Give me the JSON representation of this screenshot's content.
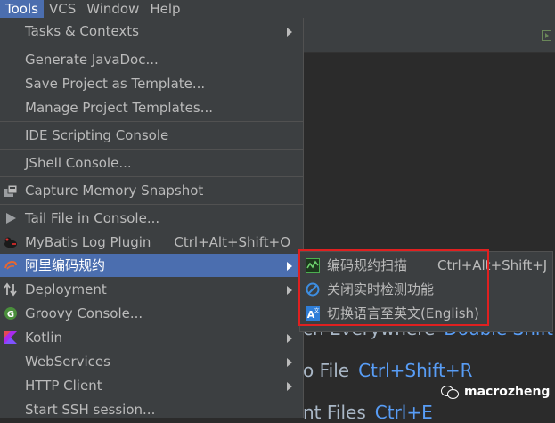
{
  "menubar": {
    "items": [
      {
        "label": "Tools",
        "active": true
      },
      {
        "label": "VCS"
      },
      {
        "label": "Window"
      },
      {
        "label": "Help"
      }
    ]
  },
  "tools_menu": {
    "items": [
      {
        "label": "Tasks & Contexts",
        "submenu": true
      },
      {
        "label": "Generate JavaDoc..."
      },
      {
        "label": "Save Project as Template..."
      },
      {
        "label": "Manage Project Templates..."
      },
      {
        "label": "IDE Scripting Console"
      },
      {
        "label": "JShell Console..."
      },
      {
        "label": "Capture Memory Snapshot",
        "icon": "memory-snapshot-icon"
      },
      {
        "label": "Tail File in Console...",
        "icon": "play-icon"
      },
      {
        "label": "MyBatis Log Plugin",
        "shortcut": "Ctrl+Alt+Shift+O",
        "icon": "bird-icon"
      },
      {
        "label": "阿里编码规约",
        "submenu": true,
        "selected": true,
        "icon": "alibaba-icon"
      },
      {
        "label": "Deployment",
        "submenu": true,
        "icon": "deployment-arrows-icon"
      },
      {
        "label": "Groovy Console...",
        "icon": "groovy-icon"
      },
      {
        "label": "Kotlin",
        "submenu": true,
        "icon": "kotlin-icon"
      },
      {
        "label": "WebServices",
        "submenu": true
      },
      {
        "label": "HTTP Client",
        "submenu": true
      },
      {
        "label": "Start SSH session..."
      }
    ]
  },
  "alibaba_submenu": {
    "items": [
      {
        "label": "编码规约扫描",
        "shortcut": "Ctrl+Alt+Shift+J",
        "icon": "scan-chart-icon"
      },
      {
        "label": "关闭实时检测功能",
        "icon": "disable-circle-icon"
      },
      {
        "label": "切换语言至英文(English)",
        "icon": "language-switch-icon"
      }
    ]
  },
  "editor_hints": [
    {
      "text": "ch Everywhere",
      "shortcut": "Double Shift"
    },
    {
      "text": "o File",
      "shortcut": "Ctrl+Shift+R"
    },
    {
      "text": "nt Files",
      "shortcut": "Ctrl+E"
    }
  ],
  "watermark": {
    "text": "macrozheng"
  },
  "colors": {
    "selection": "#4b6eaf",
    "menu_bg": "#3c3f41",
    "editor_bg": "#2b2b2b",
    "highlight_box": "#e02020",
    "shortcut_blue": "#589df6"
  }
}
